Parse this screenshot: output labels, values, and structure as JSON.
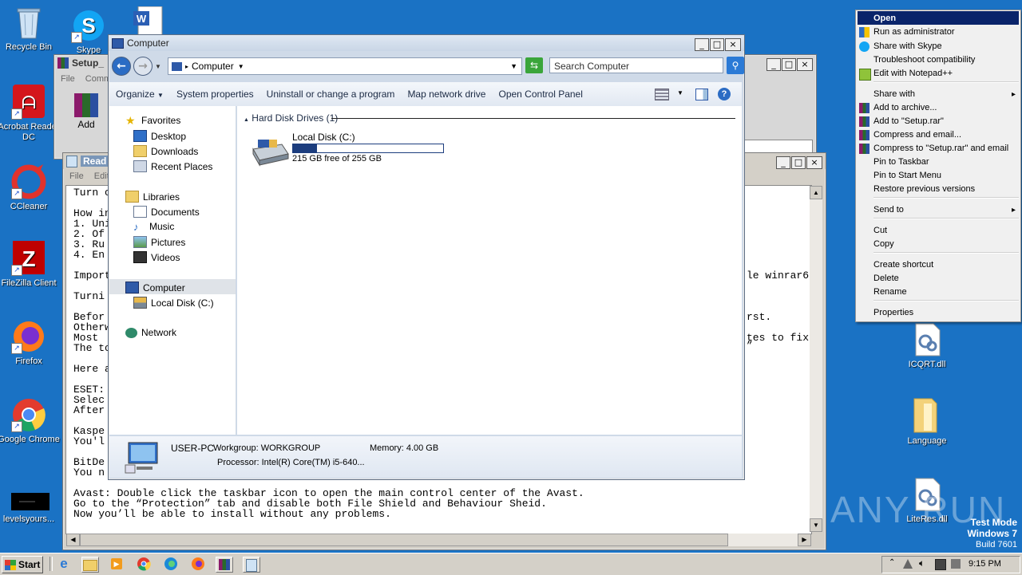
{
  "desktop": {
    "icons": [
      {
        "label": "Recycle Bin"
      },
      {
        "label": "Skype"
      },
      {
        "label": "Acrobat Reader DC"
      },
      {
        "label": "CCleaner"
      },
      {
        "label": "FileZilla Client"
      },
      {
        "label": "Firefox"
      },
      {
        "label": "Google Chrome"
      },
      {
        "label": "levelsyours..."
      },
      {
        "label": "ICQRT.dll"
      },
      {
        "label": "Language"
      },
      {
        "label": "LiteRes.dll"
      }
    ],
    "watermark": "ANY RUN",
    "test_mode": {
      "line1": "Test Mode",
      "line2": "Windows 7",
      "line3": "Build 7601"
    }
  },
  "winrar": {
    "title": "Setup_",
    "menu": [
      "File",
      "Comm"
    ],
    "add_label": "Add"
  },
  "notepad": {
    "title": "Read",
    "menu": [
      "File",
      "Edit"
    ],
    "left_lines": [
      "Turn o",
      "",
      "How in",
      "1. Uni",
      "2. Of",
      "3. Ru",
      "4. En",
      "",
      "Import",
      "",
      "Turni",
      "",
      "Befor",
      "Otherw",
      "Most ",
      "The to",
      "",
      "Here a",
      "",
      "ESET:",
      "Selec",
      "After",
      "",
      "Kaspe",
      "You'l",
      "",
      "BitDe",
      "You n"
    ],
    "right_fragments": [
      "le winrar6",
      "rst.",
      "tes to fix",
      "”"
    ],
    "bottom_lines": [
      "Avast: Double click the taskbar icon to open the main control center of the Avast.",
      "Go to the “Protection” tab and disable both File Shield and Behaviour Sheid.",
      "Now you’ll be able to install without any problems."
    ]
  },
  "explorer": {
    "title": "Computer",
    "address": "Computer",
    "search_placeholder": "Search Computer",
    "toolbar": [
      "Organize",
      "System properties",
      "Uninstall or change a program",
      "Map network drive",
      "Open Control Panel"
    ],
    "nav": {
      "favorites": "Favorites",
      "desktop": "Desktop",
      "downloads": "Downloads",
      "recent": "Recent Places",
      "libraries": "Libraries",
      "documents": "Documents",
      "music": "Music",
      "pictures": "Pictures",
      "videos": "Videos",
      "computer": "Computer",
      "local_disk": "Local Disk (C:)",
      "network": "Network"
    },
    "group_header": "Hard Disk Drives (1)",
    "drive": {
      "name": "Local Disk (C:)",
      "free_text": "215 GB free of 255 GB",
      "used_fraction": 0.157
    },
    "details": {
      "pc_name": "USER-PC",
      "workgroup": "Workgroup: WORKGROUP",
      "memory": "Memory: 4.00 GB",
      "processor": "Processor: Intel(R) Core(TM) i5-640..."
    }
  },
  "context_menu": {
    "items": [
      {
        "label": "Open",
        "icon": "",
        "highlight": true
      },
      {
        "label": "Run as administrator",
        "icon": "shield-icon"
      },
      {
        "label": "Share with Skype",
        "icon": "skype-icon"
      },
      {
        "label": "Troubleshoot compatibility",
        "icon": ""
      },
      {
        "label": "Edit with Notepad++",
        "icon": "notepadpp-icon"
      },
      {
        "label": "Share with",
        "icon": "",
        "submenu": true
      },
      {
        "label": "Add to archive...",
        "icon": "winrar-icon"
      },
      {
        "label": "Add to \"Setup.rar\"",
        "icon": "winrar-icon"
      },
      {
        "label": "Compress and email...",
        "icon": "winrar-icon"
      },
      {
        "label": "Compress to \"Setup.rar\" and email",
        "icon": "winrar-icon"
      },
      {
        "label": "Pin to Taskbar",
        "icon": ""
      },
      {
        "label": "Pin to Start Menu",
        "icon": ""
      },
      {
        "label": "Restore previous versions",
        "icon": ""
      },
      {
        "label": "Send to",
        "icon": "",
        "submenu": true
      },
      {
        "label": "Cut",
        "icon": ""
      },
      {
        "label": "Copy",
        "icon": ""
      },
      {
        "label": "Create shortcut",
        "icon": ""
      },
      {
        "label": "Delete",
        "icon": ""
      },
      {
        "label": "Rename",
        "icon": ""
      },
      {
        "label": "Properties",
        "icon": ""
      }
    ]
  },
  "taskbar": {
    "start_label": "Start",
    "clock": "9:15 PM"
  },
  "colors": {
    "desktop": "#1a72c4",
    "menu_highlight": "#0a246a",
    "drive_bar": "#1c3d7e"
  }
}
